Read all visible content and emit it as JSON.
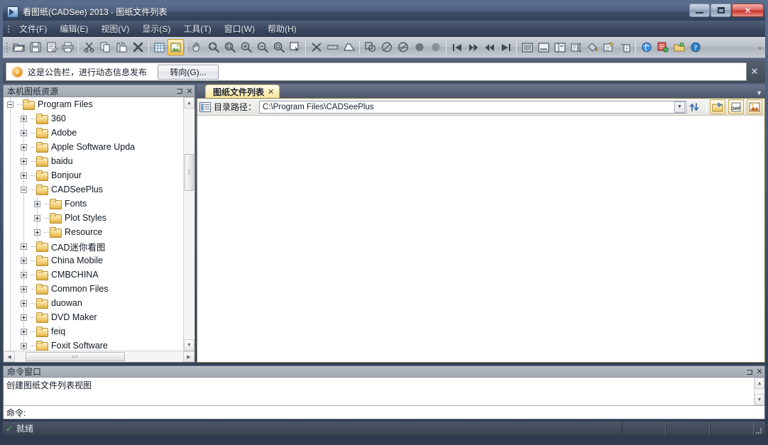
{
  "window": {
    "title": "看图纸(CADSee) 2013 - 图纸文件列表",
    "icon": "cadsee-app-icon",
    "controls": {
      "minimize": "–",
      "maximize": "❐",
      "close": "✕"
    }
  },
  "menubar": {
    "items": [
      {
        "label": "文件(F)",
        "name": "menu-file"
      },
      {
        "label": "编辑(E)",
        "name": "menu-edit"
      },
      {
        "label": "视图(V)",
        "name": "menu-view"
      },
      {
        "label": "显示(S)",
        "name": "menu-display"
      },
      {
        "label": "工具(T)",
        "name": "menu-tools"
      },
      {
        "label": "窗口(W)",
        "name": "menu-window"
      },
      {
        "label": "帮助(H)",
        "name": "menu-help"
      }
    ]
  },
  "toolbar": {
    "overflow_label": "»",
    "groups": [
      {
        "buttons": [
          {
            "icon": "open-folder-icon",
            "name": "toolbar-open"
          },
          {
            "icon": "save-icon",
            "name": "toolbar-save"
          },
          {
            "icon": "save-as-icon",
            "name": "toolbar-save-as"
          },
          {
            "icon": "print-icon",
            "name": "toolbar-print"
          }
        ]
      },
      {
        "buttons": [
          {
            "icon": "scissors-icon",
            "name": "toolbar-cut"
          },
          {
            "icon": "copy-icon",
            "name": "toolbar-copy"
          },
          {
            "icon": "paste-icon",
            "name": "toolbar-paste"
          },
          {
            "icon": "delete-x-icon",
            "name": "toolbar-delete"
          }
        ]
      },
      {
        "buttons": [
          {
            "icon": "table-view-icon",
            "name": "toolbar-table-view"
          },
          {
            "icon": "image-view-icon",
            "name": "toolbar-image-view",
            "active": true
          }
        ]
      },
      {
        "buttons": [
          {
            "icon": "pan-hand-icon",
            "name": "toolbar-pan"
          },
          {
            "icon": "zoom-extents-icon",
            "name": "toolbar-zoom-extents"
          },
          {
            "icon": "zoom-window-icon",
            "name": "toolbar-zoom-window"
          },
          {
            "icon": "zoom-in-icon",
            "name": "toolbar-zoom-in"
          },
          {
            "icon": "zoom-out-icon",
            "name": "toolbar-zoom-out"
          },
          {
            "icon": "zoom-previous-icon",
            "name": "toolbar-zoom-previous"
          },
          {
            "icon": "select-region-icon",
            "name": "toolbar-select-region"
          }
        ]
      },
      {
        "buttons": [
          {
            "icon": "measure-point-icon",
            "name": "toolbar-measure-point"
          },
          {
            "icon": "measure-length-icon",
            "name": "toolbar-measure-length"
          },
          {
            "icon": "measure-area-icon",
            "name": "toolbar-measure-area"
          }
        ]
      },
      {
        "buttons": [
          {
            "icon": "overlap-shapes-icon",
            "name": "toolbar-overlap"
          },
          {
            "icon": "circle-slash-icon",
            "name": "toolbar-circle-slash"
          },
          {
            "icon": "circle-slash2-icon",
            "name": "toolbar-circle-slash-2"
          },
          {
            "icon": "filled-circle-icon",
            "name": "toolbar-filled-circle"
          },
          {
            "icon": "filled-circle2-icon",
            "name": "toolbar-filled-circle-2"
          }
        ]
      },
      {
        "buttons": [
          {
            "icon": "first-page-icon",
            "name": "toolbar-first"
          },
          {
            "icon": "fast-forward-icon",
            "name": "toolbar-forward"
          },
          {
            "icon": "rewind-icon",
            "name": "toolbar-rewind"
          },
          {
            "icon": "last-page-icon",
            "name": "toolbar-last"
          }
        ]
      },
      {
        "buttons": [
          {
            "icon": "layout-full-icon",
            "name": "toolbar-layout-full"
          },
          {
            "icon": "layout-split-icon",
            "name": "toolbar-layout-split"
          },
          {
            "icon": "layout-panel-icon",
            "name": "toolbar-layout-panel"
          },
          {
            "icon": "layout-measure-icon",
            "name": "toolbar-layout-measure"
          },
          {
            "icon": "fill-color-icon",
            "name": "toolbar-fill-color"
          },
          {
            "icon": "properties-icon",
            "name": "toolbar-properties"
          },
          {
            "icon": "batch-icon",
            "name": "toolbar-batch"
          }
        ]
      },
      {
        "buttons": [
          {
            "icon": "browser-icon",
            "name": "toolbar-browser"
          },
          {
            "icon": "publish-icon",
            "name": "toolbar-publish"
          },
          {
            "icon": "open-online-icon",
            "name": "toolbar-open-online"
          },
          {
            "icon": "help-icon",
            "name": "toolbar-help"
          }
        ]
      }
    ]
  },
  "announcement": {
    "icon": "info-icon",
    "text": "这是公告栏，进行动态信息发布",
    "button_label": "转向(G)...",
    "close_label": "✕"
  },
  "tree_panel": {
    "title": "本机图纸资源",
    "pin_label": "⊐",
    "close_label": "✕",
    "items": [
      {
        "label": "Program Files",
        "depth": 0,
        "state": "expanded"
      },
      {
        "label": "360",
        "depth": 1,
        "state": "collapsed"
      },
      {
        "label": "Adobe",
        "depth": 1,
        "state": "collapsed"
      },
      {
        "label": "Apple Software Upda",
        "depth": 1,
        "state": "collapsed"
      },
      {
        "label": "baidu",
        "depth": 1,
        "state": "collapsed"
      },
      {
        "label": "Bonjour",
        "depth": 1,
        "state": "collapsed"
      },
      {
        "label": "CADSeePlus",
        "depth": 1,
        "state": "expanded"
      },
      {
        "label": "Fonts",
        "depth": 2,
        "state": "collapsed"
      },
      {
        "label": "Plot Styles",
        "depth": 2,
        "state": "collapsed"
      },
      {
        "label": "Resource",
        "depth": 2,
        "state": "collapsed"
      },
      {
        "label": "CAD迷你看图",
        "depth": 1,
        "state": "collapsed"
      },
      {
        "label": "China Mobile",
        "depth": 1,
        "state": "collapsed"
      },
      {
        "label": "CMBCHINA",
        "depth": 1,
        "state": "collapsed"
      },
      {
        "label": "Common Files",
        "depth": 1,
        "state": "collapsed"
      },
      {
        "label": "duowan",
        "depth": 1,
        "state": "collapsed"
      },
      {
        "label": "DVD Maker",
        "depth": 1,
        "state": "collapsed"
      },
      {
        "label": "feiq",
        "depth": 1,
        "state": "collapsed"
      },
      {
        "label": "Foxit Software",
        "depth": 1,
        "state": "collapsed"
      }
    ]
  },
  "document": {
    "tab": {
      "label": "图纸文件列表",
      "close_label": "✕"
    },
    "tabstrip_menu_label": "▼",
    "pathbar": {
      "icon": "directory-icon",
      "label": "目录路径：",
      "value": "C:\\Program Files\\CADSeePlus",
      "placeholder": "",
      "dropdown_label": "▼",
      "refresh_icon": "refresh-icon",
      "buttons": [
        {
          "icon": "image-folder-icon",
          "name": "path-button-image-folder"
        },
        {
          "icon": "dwf-file-icon",
          "name": "path-button-dwf",
          "text": "DWF"
        },
        {
          "icon": "picture-icon",
          "name": "path-button-picture"
        }
      ]
    },
    "file_list_empty": ""
  },
  "command_window": {
    "title": "命令窗口",
    "pin_label": "⊐",
    "close_label": "✕",
    "log_lines": [
      "创建图纸文件列表视图"
    ],
    "prompt_label": "命令:",
    "prompt_value": "",
    "prompt_placeholder": ""
  },
  "statusbar": {
    "check_icon": "green-check-icon",
    "text": "就绪",
    "cells": [
      "",
      "",
      ""
    ],
    "grip_icon": "resize-grip-icon"
  }
}
